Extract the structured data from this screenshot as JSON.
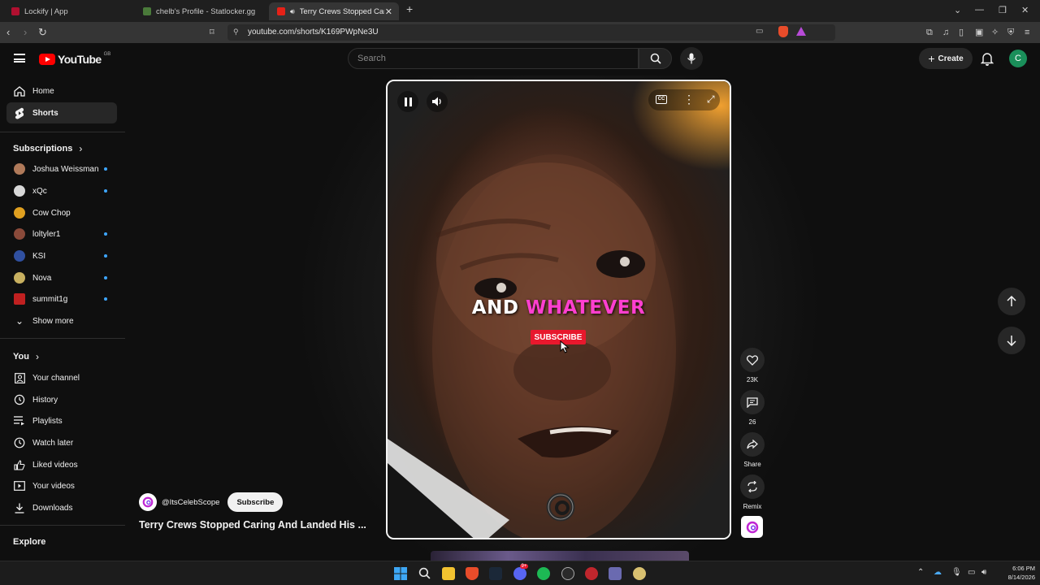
{
  "browser": {
    "tabs": [
      {
        "title": "Lockify | App",
        "active": false,
        "favicon_color": "#b01030"
      },
      {
        "title": "chelb's Profile - Statlocker.gg",
        "active": false,
        "favicon_color": "#4a7a3a"
      },
      {
        "title": "Terry Crews Stopped Caring A",
        "active": true,
        "favicon_color": "#e62117"
      }
    ],
    "url": "youtube.com/shorts/K169PWpNe3U"
  },
  "header": {
    "logo_text": "YouTube",
    "region": "GB",
    "search_placeholder": "Search",
    "create_label": "Create",
    "avatar_letter": "C"
  },
  "sidebar": {
    "main": [
      {
        "label": "Home",
        "icon": "home-icon"
      },
      {
        "label": "Shorts",
        "icon": "shorts-icon",
        "active": true
      }
    ],
    "subscriptions_title": "Subscriptions",
    "subscriptions": [
      {
        "label": "Joshua Weissman",
        "color": "#b07a5a",
        "new": true
      },
      {
        "label": "xQc",
        "color": "#d8d8d8",
        "new": true
      },
      {
        "label": "Cow Chop",
        "color": "#e0a020",
        "new": false
      },
      {
        "label": "loltyler1",
        "color": "#8a4a3a",
        "new": true
      },
      {
        "label": "KSI",
        "color": "#3050a0",
        "new": true
      },
      {
        "label": "Nova",
        "color": "#c8b060",
        "new": true
      },
      {
        "label": "summit1g",
        "color": "#c02020",
        "new": true
      }
    ],
    "show_more": "Show more",
    "you_title": "You",
    "you_items": [
      {
        "label": "Your channel",
        "icon": "channel-icon"
      },
      {
        "label": "History",
        "icon": "history-icon"
      },
      {
        "label": "Playlists",
        "icon": "playlists-icon"
      },
      {
        "label": "Watch later",
        "icon": "watch-later-icon"
      },
      {
        "label": "Liked videos",
        "icon": "liked-icon"
      },
      {
        "label": "Your videos",
        "icon": "your-videos-icon"
      },
      {
        "label": "Downloads",
        "icon": "download-icon"
      }
    ],
    "explore_title": "Explore"
  },
  "video": {
    "caption_white": "AND",
    "caption_pink": "WHATEVER",
    "subscribe_badge": "SUBSCRIBE",
    "channel_handle": "@ItsCelebScope",
    "subscribe_button": "Subscribe",
    "title": "Terry Crews Stopped Caring And Landed His ..."
  },
  "actions": {
    "likes": "23K",
    "comments": "26",
    "share": "Share",
    "remix": "Remix"
  },
  "taskbar": {
    "time": "6:06 PM",
    "date": "8/14/2026",
    "discord_badge": "9+"
  }
}
